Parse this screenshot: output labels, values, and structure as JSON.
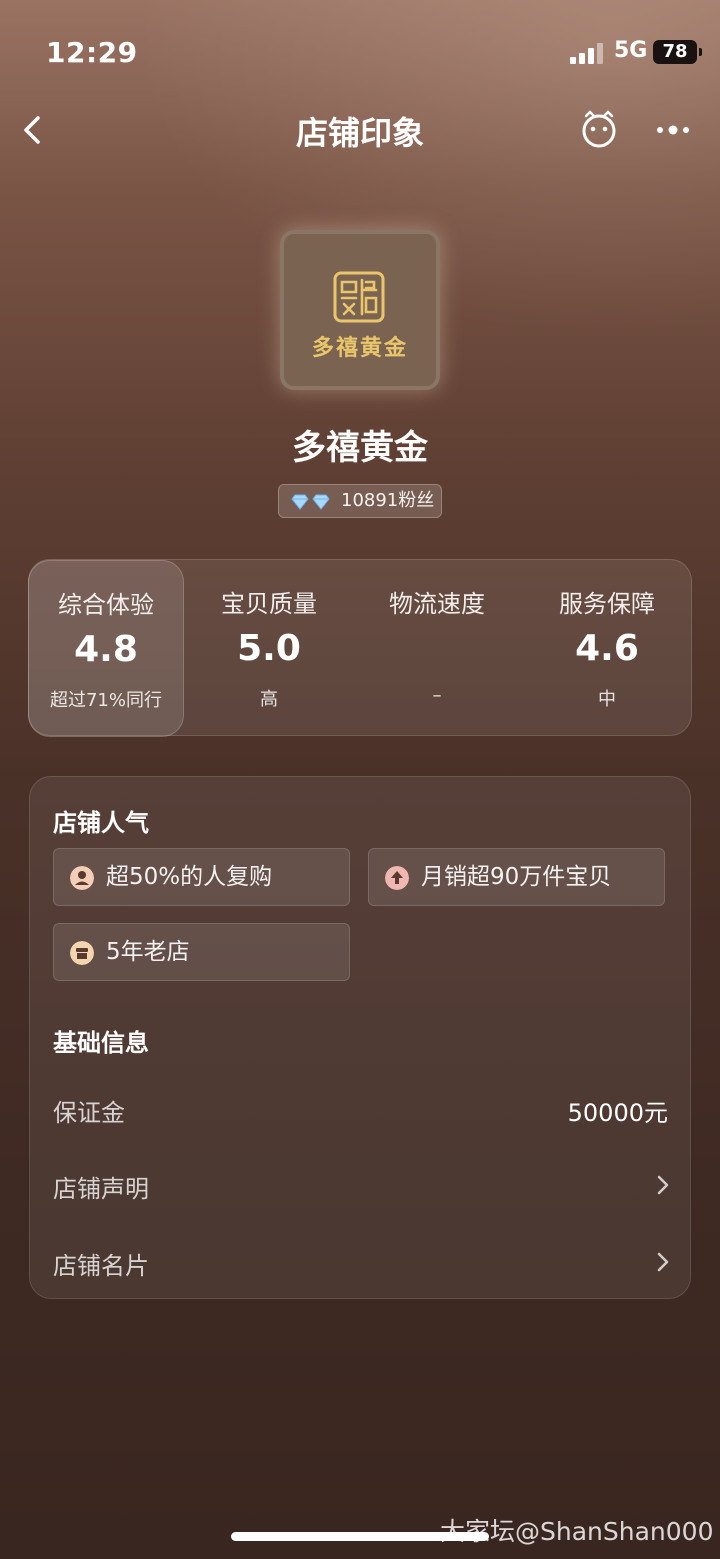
{
  "status_bar": {
    "time": "12:29",
    "network": "5G",
    "battery": "78"
  },
  "nav": {
    "title": "店铺印象"
  },
  "shop": {
    "logo_text": "多禧黄金",
    "name": "多禧黄金",
    "fans": "10891粉丝"
  },
  "scores": [
    {
      "label": "综合体验",
      "value": "4.8",
      "sub": "超过71%同行"
    },
    {
      "label": "宝贝质量",
      "value": "5.0",
      "sub": "高"
    },
    {
      "label": "物流速度",
      "value": "",
      "sub": "–"
    },
    {
      "label": "服务保障",
      "value": "4.6",
      "sub": "中"
    }
  ],
  "popularity": {
    "title": "店铺人气",
    "tags": [
      {
        "text": "超50%的人复购",
        "icon": "person-icon"
      },
      {
        "text": "月销超90万件宝贝",
        "icon": "arrow-up-icon"
      },
      {
        "text": "5年老店",
        "icon": "store-icon"
      }
    ]
  },
  "basic_info": {
    "title": "基础信息",
    "rows": [
      {
        "label": "保证金",
        "value": "50000元"
      },
      {
        "label": "店铺声明"
      },
      {
        "label": "店铺名片"
      }
    ]
  },
  "watermark": "大家坛@ShanShan000",
  "colors": {
    "gold": "#e9c66b",
    "accent_pink": "#e86a6a"
  }
}
